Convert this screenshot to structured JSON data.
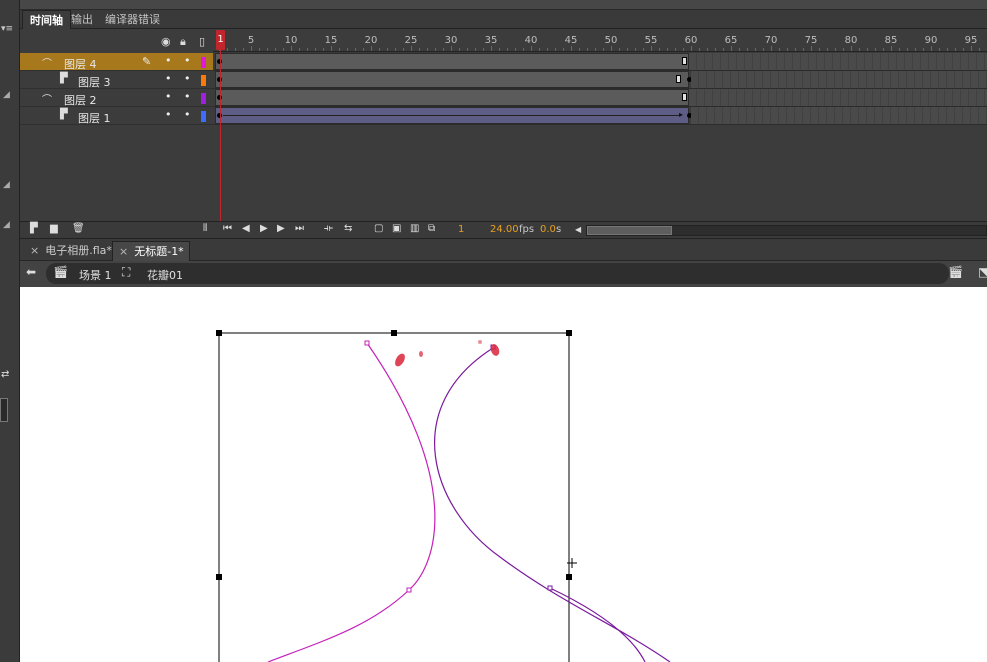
{
  "panel_tabs": [
    "时间轴",
    "输出",
    "编译器错误"
  ],
  "timeline": {
    "header_icons": {
      "eye": "eye-icon",
      "lock": "lock-icon",
      "outline": "outline-icon"
    },
    "ruler_labels": [
      "1",
      "5",
      "10",
      "15",
      "20",
      "25",
      "30",
      "35",
      "40",
      "45",
      "50",
      "55",
      "60",
      "65",
      "70",
      "75",
      "80",
      "85",
      "90",
      "95"
    ],
    "playhead_frame": "1",
    "layers": [
      {
        "name": "图层 4",
        "type": "guide",
        "selected": true,
        "color": "#e01ad8",
        "pencil": true
      },
      {
        "name": "图层 3",
        "type": "normal",
        "selected": false,
        "color": "#ff7a00"
      },
      {
        "name": "图层 2",
        "type": "guide",
        "selected": false,
        "color": "#a020e0"
      },
      {
        "name": "图层 1",
        "type": "normal",
        "selected": false,
        "color": "#3d6dff",
        "tween": true
      }
    ],
    "footer": {
      "current_frame": "1",
      "fps_value": "24.00",
      "fps_unit": "fps",
      "time_value": "0.0",
      "time_unit": "s"
    }
  },
  "doc_tabs": [
    {
      "label": "电子相册.fla*",
      "active": false
    },
    {
      "label": "无标题-1*",
      "active": true
    }
  ],
  "breadcrumb": {
    "scene": "场景 1",
    "symbol": "花瓣01"
  },
  "colors": {
    "selected_layer": "#a8791c",
    "playhead": "#c0262c",
    "guide_path_1": "#c51fb8",
    "guide_path_2": "#7a1a9e",
    "petal": "#d8243a"
  }
}
